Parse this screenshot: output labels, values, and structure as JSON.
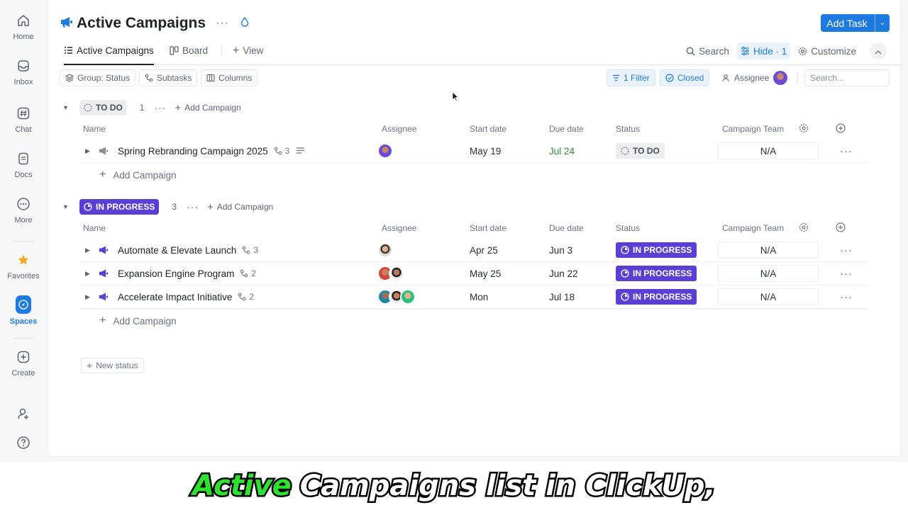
{
  "rail": [
    {
      "label": "Home",
      "icon": "home-icon"
    },
    {
      "label": "Inbox",
      "icon": "inbox-icon"
    },
    {
      "label": "Chat",
      "icon": "hash-icon"
    },
    {
      "label": "Docs",
      "icon": "doc-icon"
    },
    {
      "label": "More",
      "icon": "more-icon"
    },
    {
      "label": "Favorites",
      "icon": "star-icon"
    },
    {
      "label": "Spaces",
      "icon": "compass-icon",
      "active": true
    },
    {
      "label": "Create",
      "icon": "plus-square-icon"
    }
  ],
  "header": {
    "title": "Active Campaigns",
    "add_task": "Add Task"
  },
  "tabs": {
    "active": "Active Campaigns",
    "board": "Board",
    "view": "View"
  },
  "tools": {
    "search": "Search",
    "hide": "Hide · 1",
    "customize": "Customize"
  },
  "filters": {
    "group": "Group: Status",
    "subtasks": "Subtasks",
    "columns": "Columns",
    "filter": "1 Filter",
    "closed": "Closed",
    "assignee": "Assignee",
    "search_placeholder": "Search..."
  },
  "columns": {
    "name": "Name",
    "assignee": "Assignee",
    "start": "Start date",
    "due": "Due date",
    "status": "Status",
    "team": "Campaign Team"
  },
  "groups": [
    {
      "status": "TO DO",
      "count": "1",
      "add_label": "Add Campaign",
      "rows": [
        {
          "name": "Spring Rebranding Campaign 2025",
          "subtasks": "3",
          "start": "May 19",
          "due": "Jul 24",
          "status": "TO DO",
          "team": "N/A"
        }
      ]
    },
    {
      "status": "IN PROGRESS",
      "count": "3",
      "add_label": "Add Campaign",
      "rows": [
        {
          "name": "Automate & Elevate Launch",
          "subtasks": "3",
          "start": "Apr 25",
          "due": "Jun 3",
          "status": "IN PROGRESS",
          "team": "N/A"
        },
        {
          "name": "Expansion Engine Program",
          "subtasks": "2",
          "start": "May 25",
          "due": "Jun 22",
          "status": "IN PROGRESS",
          "team": "N/A"
        },
        {
          "name": "Accelerate Impact Initiative",
          "subtasks": "2",
          "start": "Mon",
          "due": "Jul 18",
          "status": "IN PROGRESS",
          "team": "N/A"
        }
      ]
    }
  ],
  "add_row_label": "Add Campaign",
  "new_status": "New status",
  "caption": {
    "highlight": "Active",
    "rest": "Campaigns list in ClickUp,"
  },
  "colors": {
    "accent": "#1f7ae0",
    "in_progress": "#5b3fd4",
    "due_green": "#2e8b3a"
  }
}
